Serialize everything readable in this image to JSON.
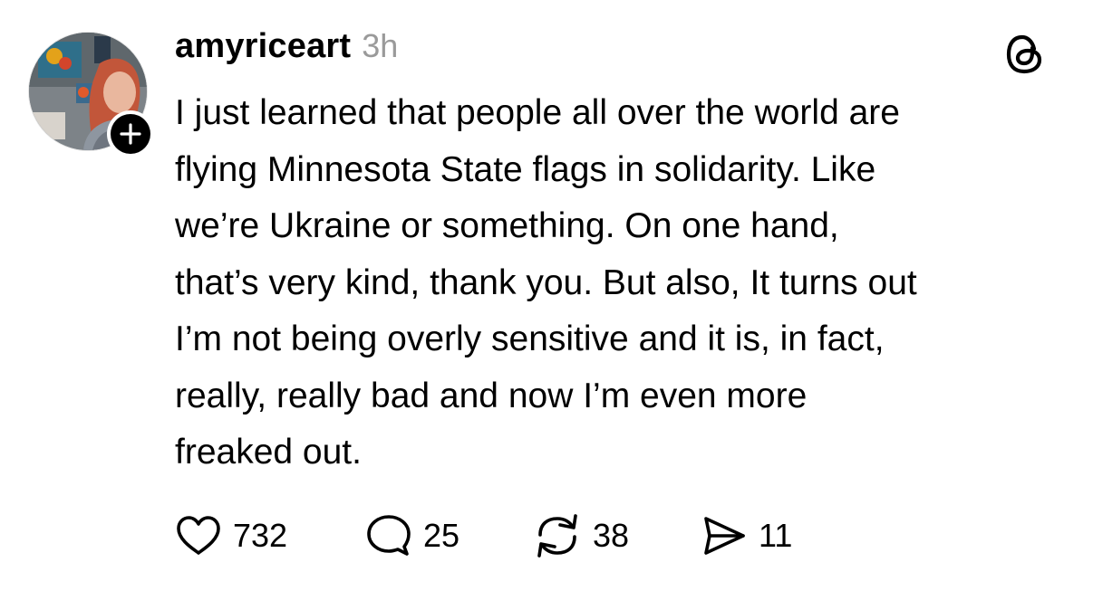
{
  "post": {
    "author": {
      "username": "amyriceart",
      "timestamp": "3h",
      "avatar_icon": "profile-photo",
      "follow_icon": "plus-icon"
    },
    "app_icon": "threads-logo-icon",
    "lines": [
      "I just learned that people all over the world are",
      "flying Minnesota State flags in solidarity. Like",
      "we’re Ukraine or something. On one hand,",
      "that’s very kind, thank you. But also, It turns out",
      "I’m not being overly sensitive and it is, in fact,",
      "really, really bad and now I’m even more",
      "freaked out."
    ],
    "actions": {
      "likes": "732",
      "replies": "25",
      "reposts": "38",
      "shares": "11"
    }
  },
  "colors": {
    "text": "#000000",
    "muted": "#9a9a9a",
    "background": "#ffffff"
  }
}
